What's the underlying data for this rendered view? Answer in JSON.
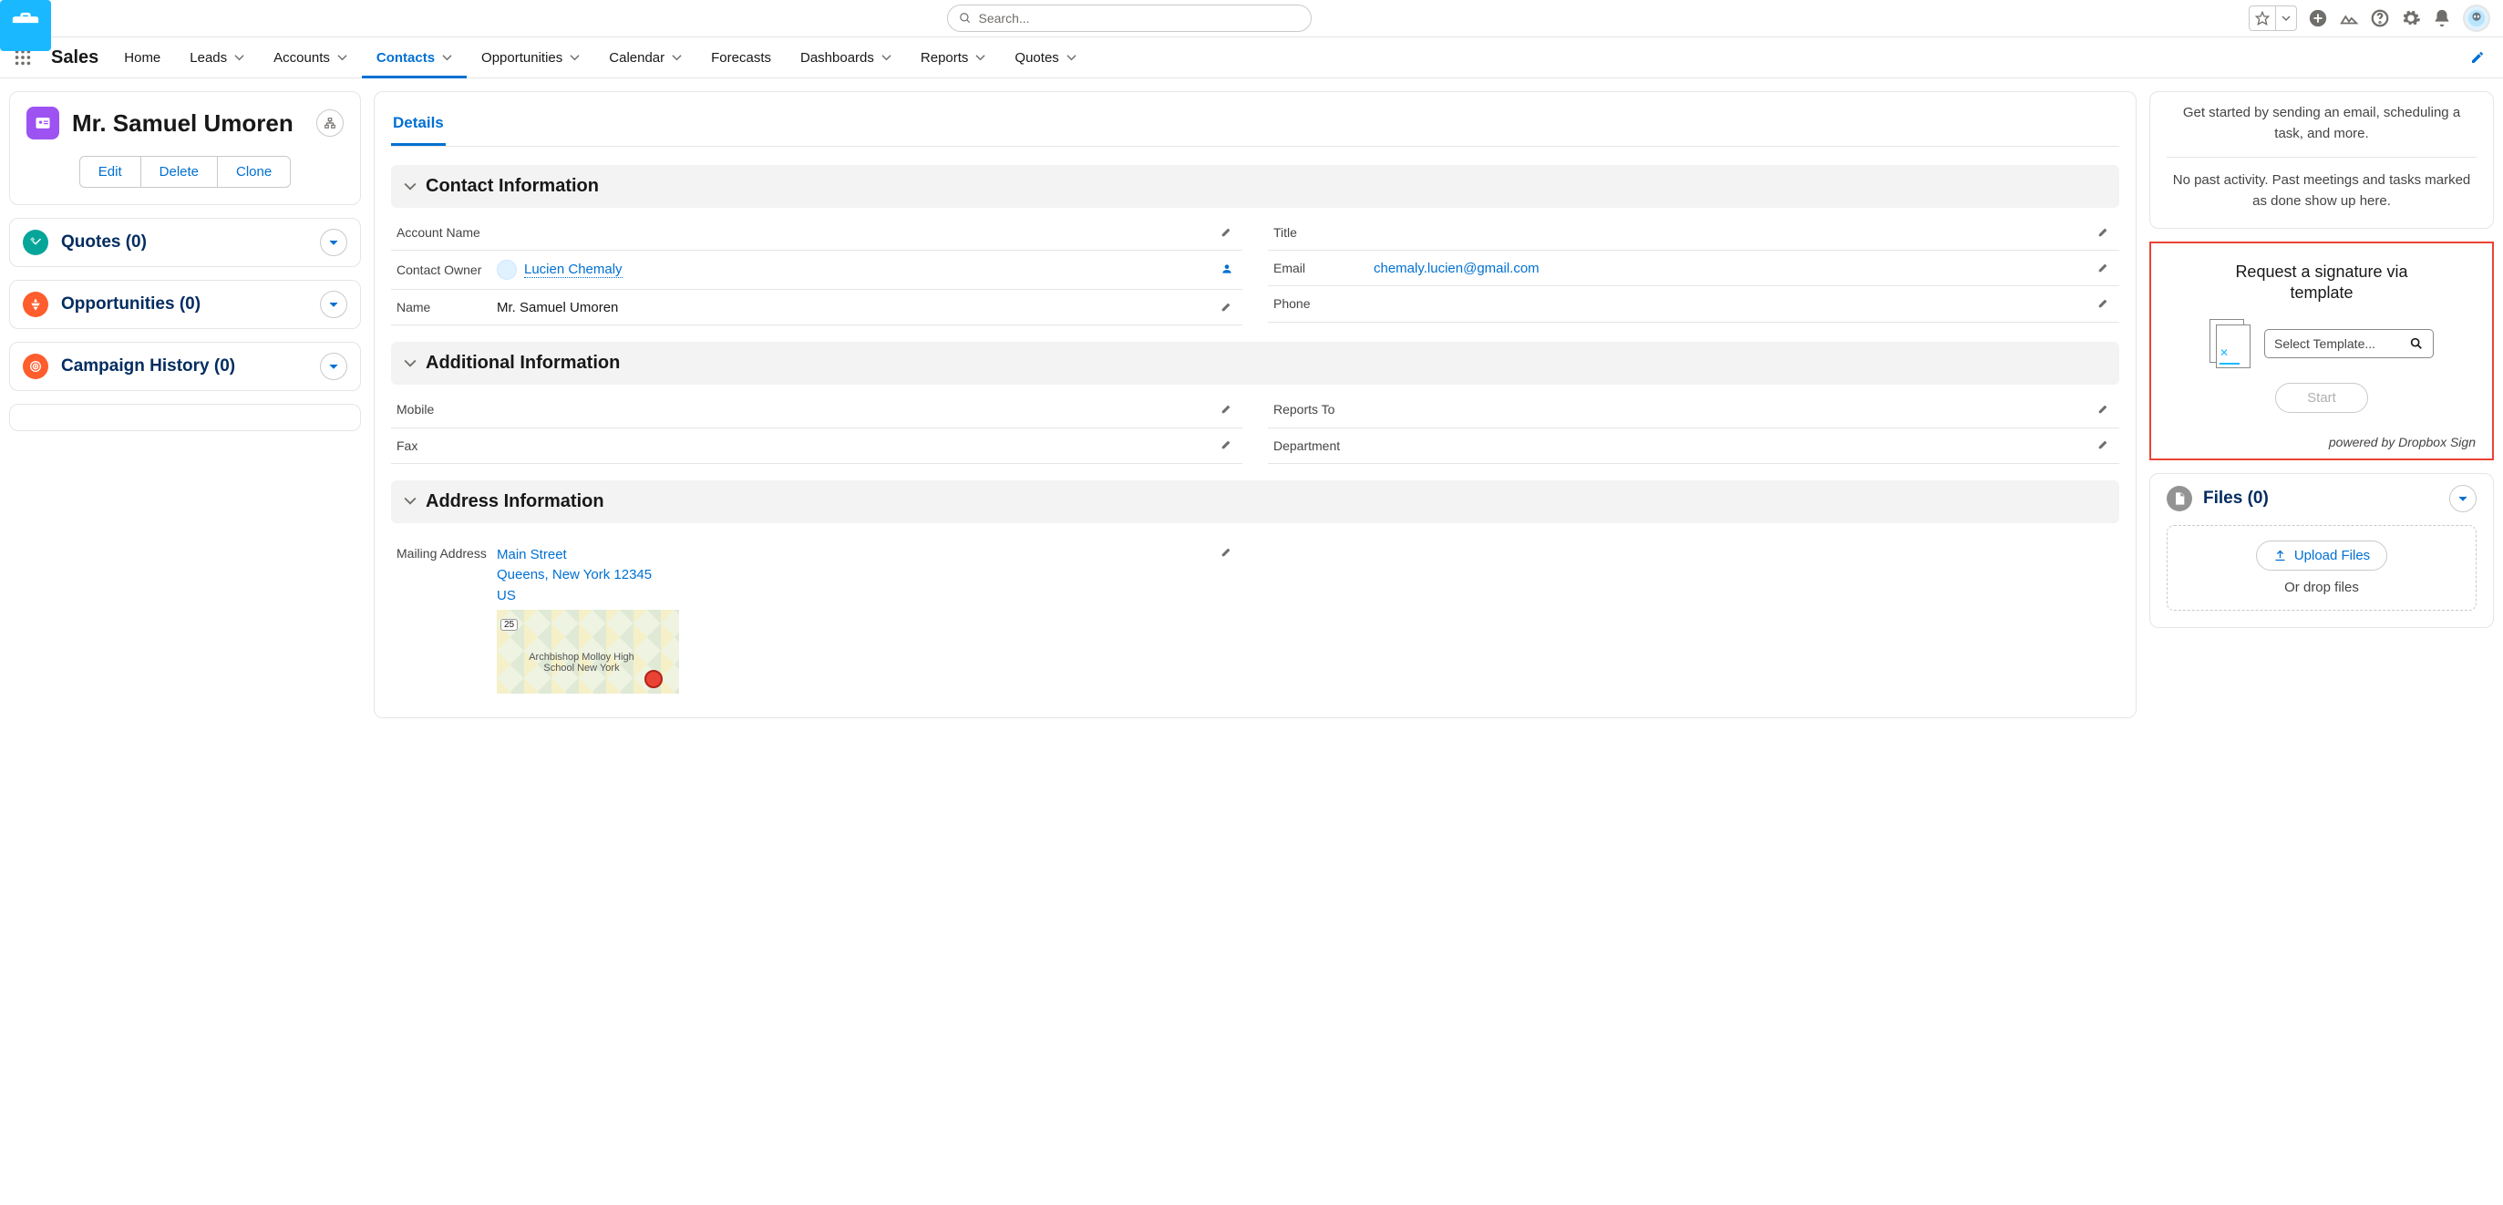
{
  "topbar": {
    "search_placeholder": "Search..."
  },
  "nav": {
    "app_name": "Sales",
    "items": [
      {
        "label": "Home",
        "dd": false
      },
      {
        "label": "Leads",
        "dd": true
      },
      {
        "label": "Accounts",
        "dd": true
      },
      {
        "label": "Contacts",
        "dd": true,
        "active": true
      },
      {
        "label": "Opportunities",
        "dd": true
      },
      {
        "label": "Calendar",
        "dd": true
      },
      {
        "label": "Forecasts",
        "dd": false
      },
      {
        "label": "Dashboards",
        "dd": true
      },
      {
        "label": "Reports",
        "dd": true
      },
      {
        "label": "Quotes",
        "dd": true
      }
    ]
  },
  "left": {
    "contact_name": "Mr. Samuel Umoren",
    "actions": {
      "edit": "Edit",
      "delete": "Delete",
      "clone": "Clone"
    },
    "related": [
      {
        "title": "Quotes (0)",
        "color": "green"
      },
      {
        "title": "Opportunities (0)",
        "color": "orange"
      },
      {
        "title": "Campaign History (0)",
        "color": "target"
      }
    ]
  },
  "center": {
    "tab_details": "Details",
    "sections": {
      "contact_info": "Contact Information",
      "additional_info": "Additional Information",
      "address_info": "Address Information"
    },
    "fields": {
      "account_name": {
        "label": "Account Name",
        "value": ""
      },
      "contact_owner": {
        "label": "Contact Owner",
        "value": "Lucien Chemaly"
      },
      "name": {
        "label": "Name",
        "value": "Mr. Samuel Umoren"
      },
      "title": {
        "label": "Title",
        "value": ""
      },
      "email": {
        "label": "Email",
        "value": "chemaly.lucien@gmail.com"
      },
      "phone": {
        "label": "Phone",
        "value": ""
      },
      "mobile": {
        "label": "Mobile",
        "value": ""
      },
      "fax": {
        "label": "Fax",
        "value": ""
      },
      "reports_to": {
        "label": "Reports To",
        "value": ""
      },
      "department": {
        "label": "Department",
        "value": ""
      },
      "mailing": {
        "label": "Mailing Address",
        "line1": "Main Street",
        "line2": "Queens, New York 12345",
        "line3": "US"
      }
    },
    "map": {
      "route": "25",
      "label": "Archbishop Molloy High School New York"
    }
  },
  "right": {
    "activity": {
      "hint1": "Get started by sending an email, scheduling a task, and more.",
      "hint2": "No past activity. Past meetings and tasks marked as done show up here."
    },
    "sign": {
      "title": "Request a signature via template",
      "select_placeholder": "Select Template...",
      "start": "Start",
      "footer": "powered by Dropbox Sign"
    },
    "files": {
      "title": "Files (0)",
      "upload": "Upload Files",
      "drop": "Or drop files"
    }
  }
}
